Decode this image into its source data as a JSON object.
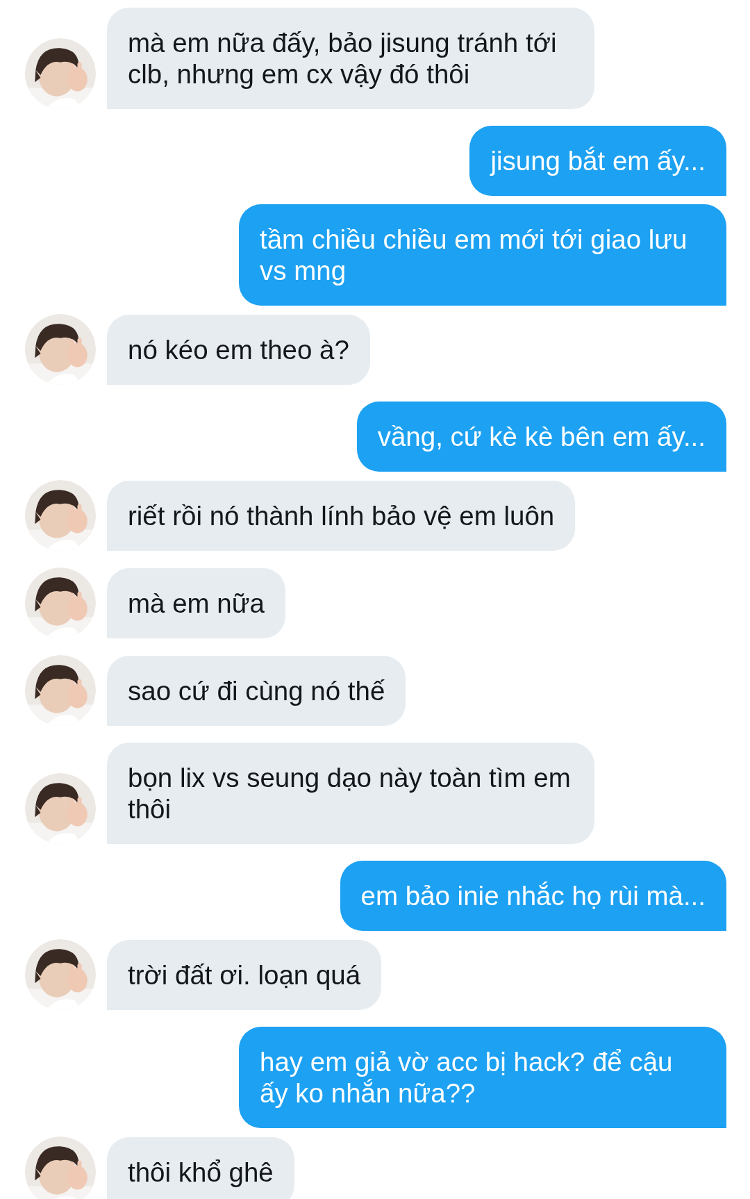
{
  "messages": [
    {
      "kind": "in",
      "text": "mà em nữa đấy, bảo jisung tránh tới clb, nhưng em cx vậy đó thôi"
    },
    {
      "kind": "out",
      "text": "jisung bắt em ấy..."
    },
    {
      "kind": "out",
      "text": "tầm chiều chiều em mới tới giao lưu vs mng"
    },
    {
      "kind": "in",
      "text": "nó kéo em theo à?"
    },
    {
      "kind": "out",
      "text": "vầng, cứ kè kè bên em ấy..."
    },
    {
      "kind": "in",
      "text": "riết rồi nó thành lính bảo vệ em luôn"
    },
    {
      "kind": "in",
      "text": "mà em nữa"
    },
    {
      "kind": "in",
      "text": "sao cứ đi cùng nó thế"
    },
    {
      "kind": "in",
      "text": "bọn lix vs seung dạo này toàn tìm em thôi"
    },
    {
      "kind": "out",
      "text": "em bảo inie nhắc họ rùi mà..."
    },
    {
      "kind": "in",
      "text": "trời đất ơi. loạn quá"
    },
    {
      "kind": "out",
      "text": "hay em giả vờ acc bị hack? để cậu ấy ko nhắn nữa??"
    },
    {
      "kind": "in",
      "text": "thôi khổ ghê"
    }
  ]
}
